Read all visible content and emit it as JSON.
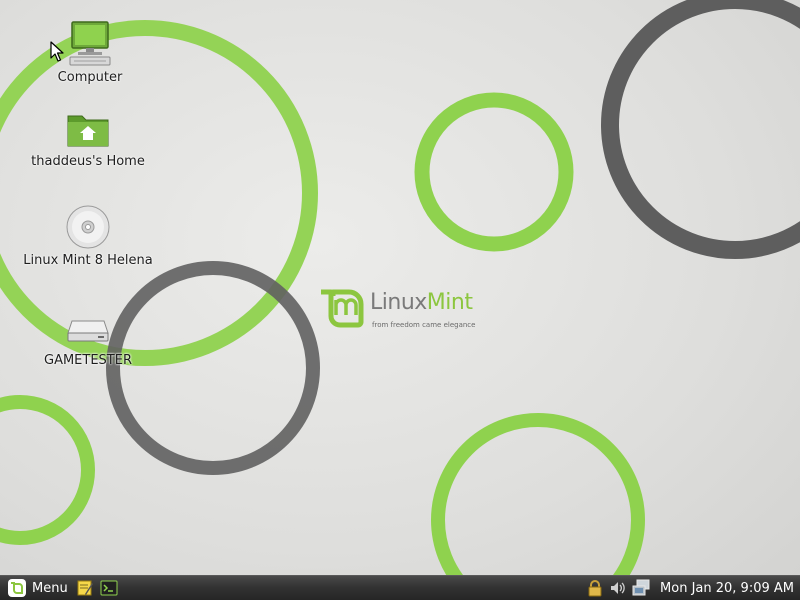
{
  "colors": {
    "mint_green": "#8cc63f",
    "ring_green": "#8fd24e",
    "ring_gray": "#5e5e5e",
    "panel_bg": "#333333",
    "panel_text": "#ffffff"
  },
  "desktop": {
    "icons": [
      {
        "label": "Computer",
        "icon": "computer-icon"
      },
      {
        "label": "thaddeus's Home",
        "icon": "home-folder-icon"
      },
      {
        "label": "Linux Mint 8 Helena",
        "icon": "optical-disc-icon"
      },
      {
        "label": "GAMETESTER",
        "icon": "drive-icon"
      }
    ],
    "logo": {
      "wordmark_linux": "Linux",
      "wordmark_mint": "Mint",
      "tagline": "from freedom came elegance"
    }
  },
  "panel": {
    "menu_label": "Menu",
    "launchers": [
      {
        "icon": "text-editor-icon"
      },
      {
        "icon": "terminal-icon"
      }
    ],
    "tray": [
      {
        "icon": "lock-icon"
      },
      {
        "icon": "volume-icon"
      },
      {
        "icon": "network-icon"
      }
    ],
    "clock": "Mon Jan 20,  9:09 AM"
  }
}
